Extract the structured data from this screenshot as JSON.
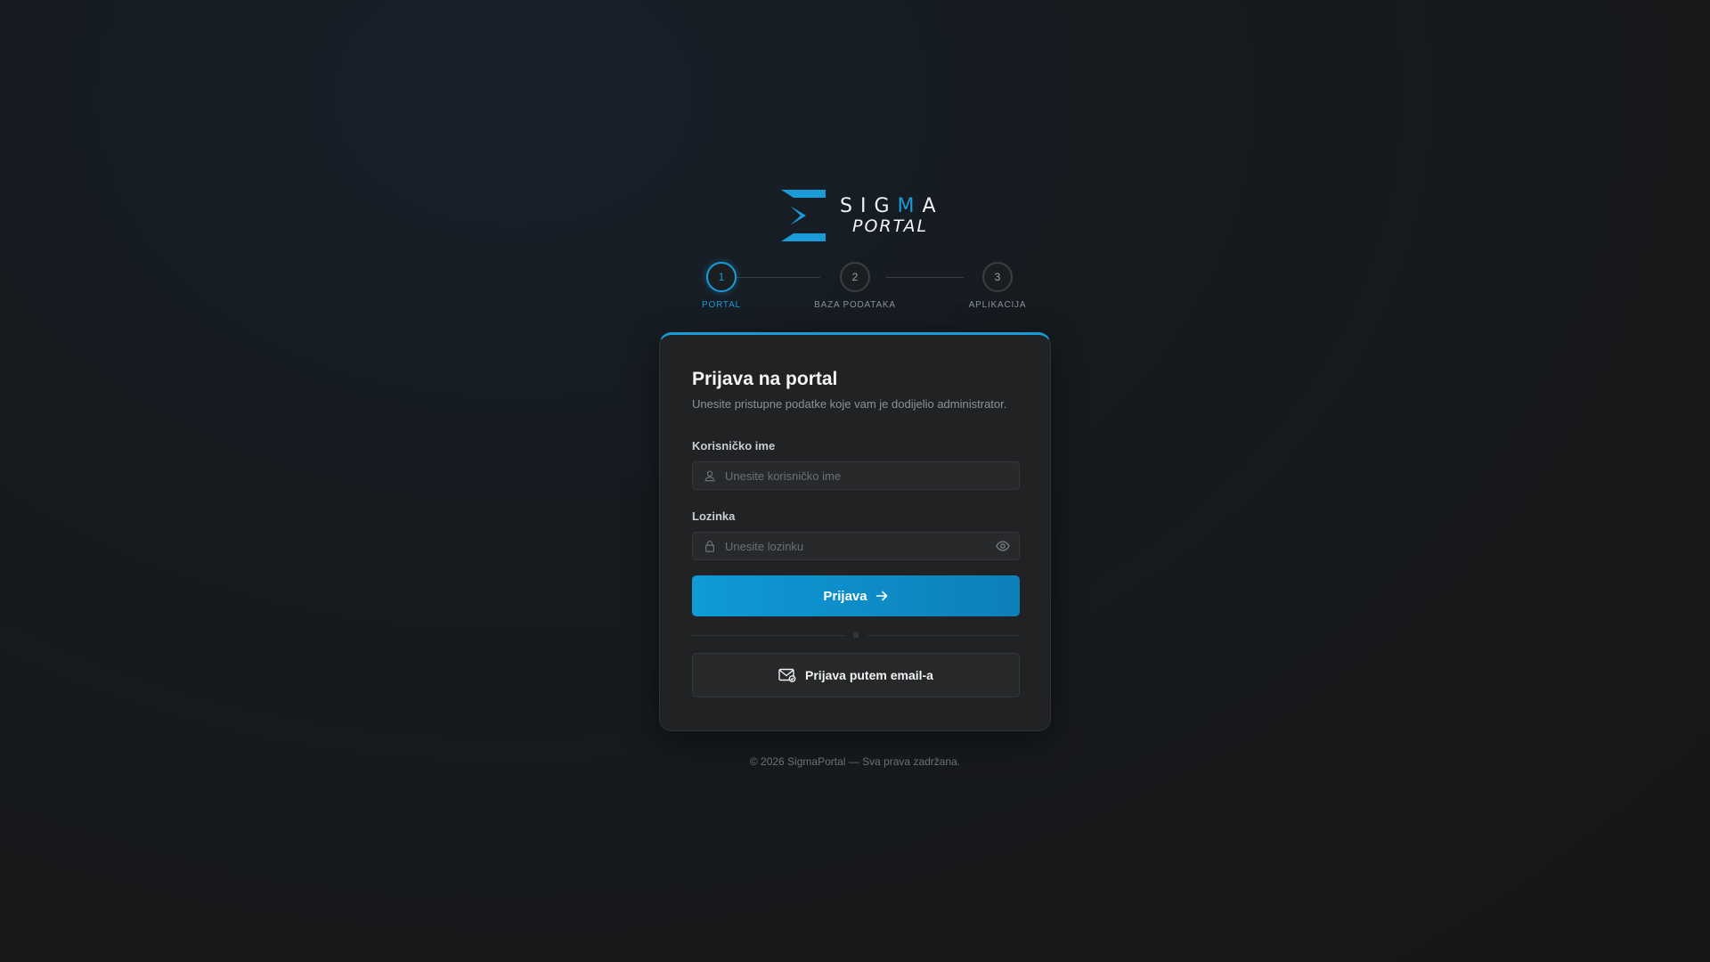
{
  "brand": {
    "word_pre": "SIG",
    "word_hl": "M",
    "word_post": "A",
    "sub": "PORTAL",
    "accent": "#1a9ad6"
  },
  "stepper": {
    "steps": [
      {
        "number": "1",
        "label": "PORTAL",
        "active": true
      },
      {
        "number": "2",
        "label": "BAZA PODATAKA",
        "active": false
      },
      {
        "number": "3",
        "label": "APLIKACIJA",
        "active": false
      }
    ]
  },
  "login": {
    "title": "Prijava na portal",
    "subtitle": "Unesite pristupne podatke koje vam je dodijelio administrator.",
    "username_label": "Korisničko ime",
    "username_placeholder": "Unesite korisničko ime",
    "username_icon": "user-icon",
    "password_label": "Lozinka",
    "password_placeholder": "Unesite lozinku",
    "password_icon": "lock-icon",
    "toggle_icon": "eye-icon",
    "submit_label": "Prijava",
    "submit_icon": "arrow-right-icon",
    "divider_text": "ili",
    "email_label": "Prijava putem email-a",
    "email_icon": "mail-icon"
  },
  "footer": {
    "text": "© 2026 SigmaPortal — Sva prava zadržana."
  }
}
